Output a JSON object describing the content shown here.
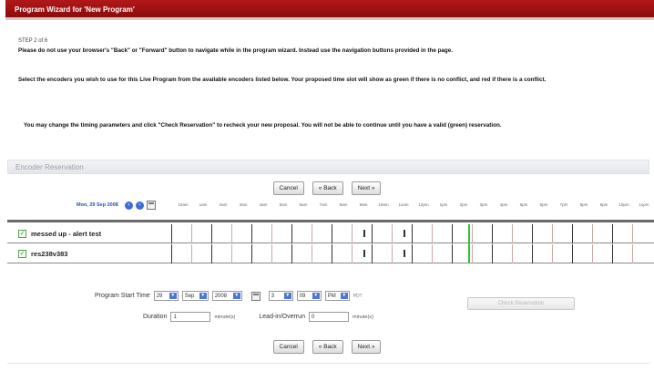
{
  "window": {
    "title": "Program Wizard for 'New Program'"
  },
  "intro": {
    "step": "STEP 2 of 6",
    "p1": "Please do not use your browser's \"Back\" or \"Forward\" button to navigate while in the program wizard. Instead use the navigation buttons provided in the page.",
    "p2": "Select the encoders you wish to use for this Live Program from the available encoders listed below. Your proposed time slot will show as green if there is no conflict, and red if there is a conflict.",
    "p3": "You may change the timing parameters and click \"Check Reservation\" to recheck your new proposal. You will not be able to continue until you have a valid (green) reservation."
  },
  "section": {
    "title": "Encoder Reservation"
  },
  "nav": {
    "cancel": "Cancel",
    "back": "« Back",
    "next": "Next »"
  },
  "timeline": {
    "date": "Mon, 29 Sep 2008",
    "prev_icon": "arrow-left-icon",
    "next_icon": "arrow-right-icon",
    "calendar_icon": "calendar-icon",
    "hours": [
      "12am",
      "1am",
      "2am",
      "3am",
      "4am",
      "5am",
      "6am",
      "7am",
      "8am",
      "9am",
      "10am",
      "11am",
      "12pm",
      "1pm",
      "2pm",
      "3pm",
      "4pm",
      "5pm",
      "6pm",
      "7pm",
      "8pm",
      "9pm",
      "10pm",
      "11pm"
    ],
    "now_color": "#2fc42f"
  },
  "encoders": [
    {
      "name": "messed up - alert test",
      "checked": true
    },
    {
      "name": "res238v383",
      "checked": true
    }
  ],
  "form": {
    "start_label": "Program Start Time",
    "day": "29",
    "month": "Sep",
    "year": "2008",
    "hour": "3",
    "minute": "09",
    "ampm": "PM",
    "tz": "PDT",
    "duration_label": "Duration",
    "duration": "1",
    "duration_unit": "minute(s)",
    "leadin_label": "Lead-in/Overrun",
    "leadin": "0",
    "leadin_unit": "minute(s)",
    "check_button": "Check Reservation"
  },
  "colors": {
    "title_bar": "#a01414",
    "accent_blue": "#3d6fd0"
  }
}
